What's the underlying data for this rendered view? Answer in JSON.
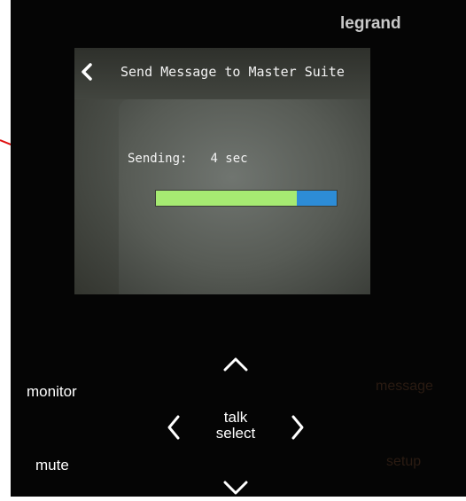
{
  "brand": "legrand",
  "screen": {
    "back_icon": "chevron-left-icon",
    "title": "Send Message to Master Suite",
    "status_label": "Sending:",
    "status_value": "4 sec",
    "progress": 0.78,
    "colors": {
      "progress_fill": "#a6ea72",
      "progress_track": "#2d8cd6"
    }
  },
  "controls": {
    "monitor": "monitor",
    "mute": "mute",
    "message": "message",
    "setup": "setup",
    "talk": "talk",
    "select": "select",
    "up_icon": "chevron-up-icon",
    "down_icon": "chevron-down-icon",
    "left_icon": "chevron-left-icon",
    "right_icon": "chevron-right-icon"
  },
  "annotation": {
    "color": "#e01010",
    "icon": "arrow-annotation"
  }
}
